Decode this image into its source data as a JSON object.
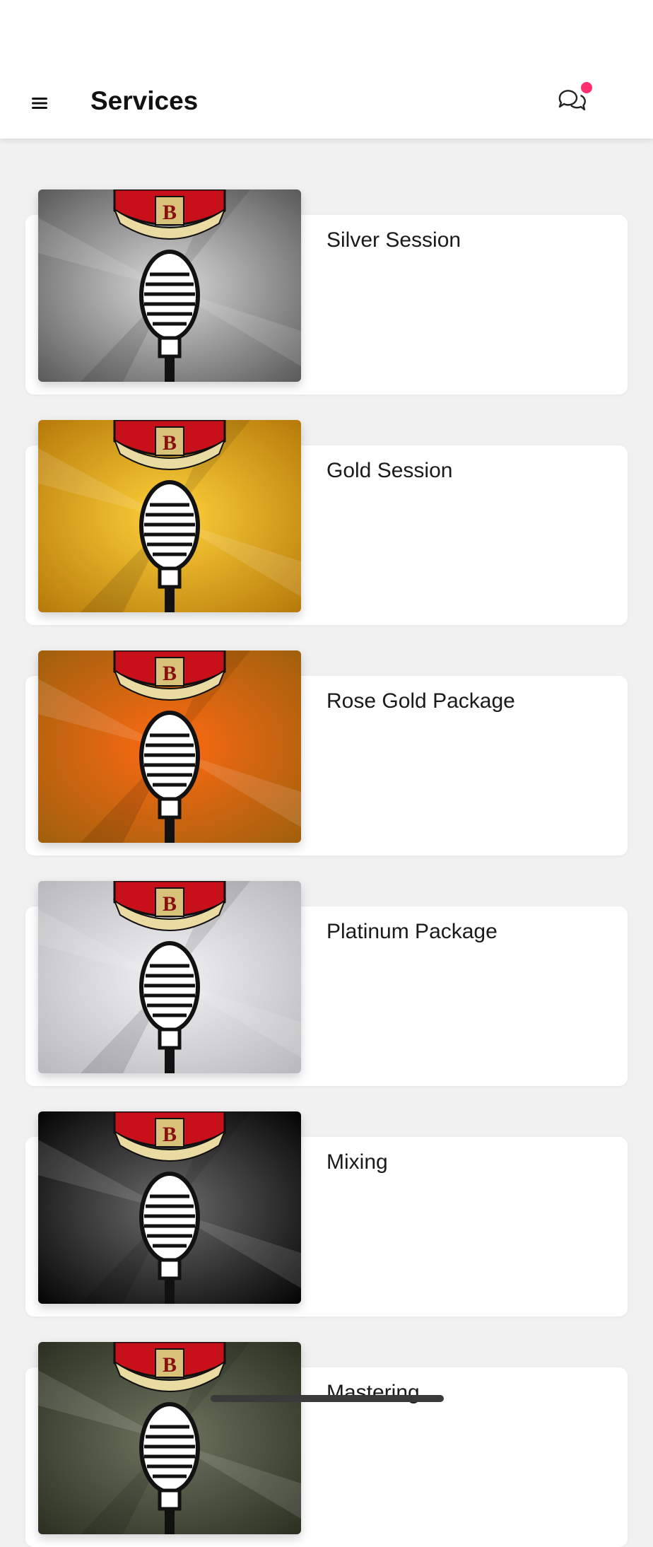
{
  "header": {
    "title": "Services",
    "menu_icon": "hamburger-menu-icon",
    "chat_icon": "chat-bubbles-icon",
    "notification_dot_color": "#ff2d6d"
  },
  "services": [
    {
      "label": "Silver Session",
      "bg_center": "#d9d9d9",
      "bg_edge": "#5a5a5a",
      "theme": "silver"
    },
    {
      "label": "Gold Session",
      "bg_center": "#ffd23a",
      "bg_edge": "#b77a0a",
      "theme": "gold"
    },
    {
      "label": "Rose Gold Package",
      "bg_center": "#ff6a12",
      "bg_edge": "#a0600d",
      "theme": "rose-gold"
    },
    {
      "label": "Platinum Package",
      "bg_center": "#f2f2f4",
      "bg_edge": "#b9b9bd",
      "theme": "platinum"
    },
    {
      "label": "Mixing",
      "bg_center": "#6a6a6a",
      "bg_edge": "#050505",
      "theme": "black"
    },
    {
      "label": "Mastering",
      "bg_center": "#6f7560",
      "bg_edge": "#2b3022",
      "theme": "olive"
    }
  ]
}
